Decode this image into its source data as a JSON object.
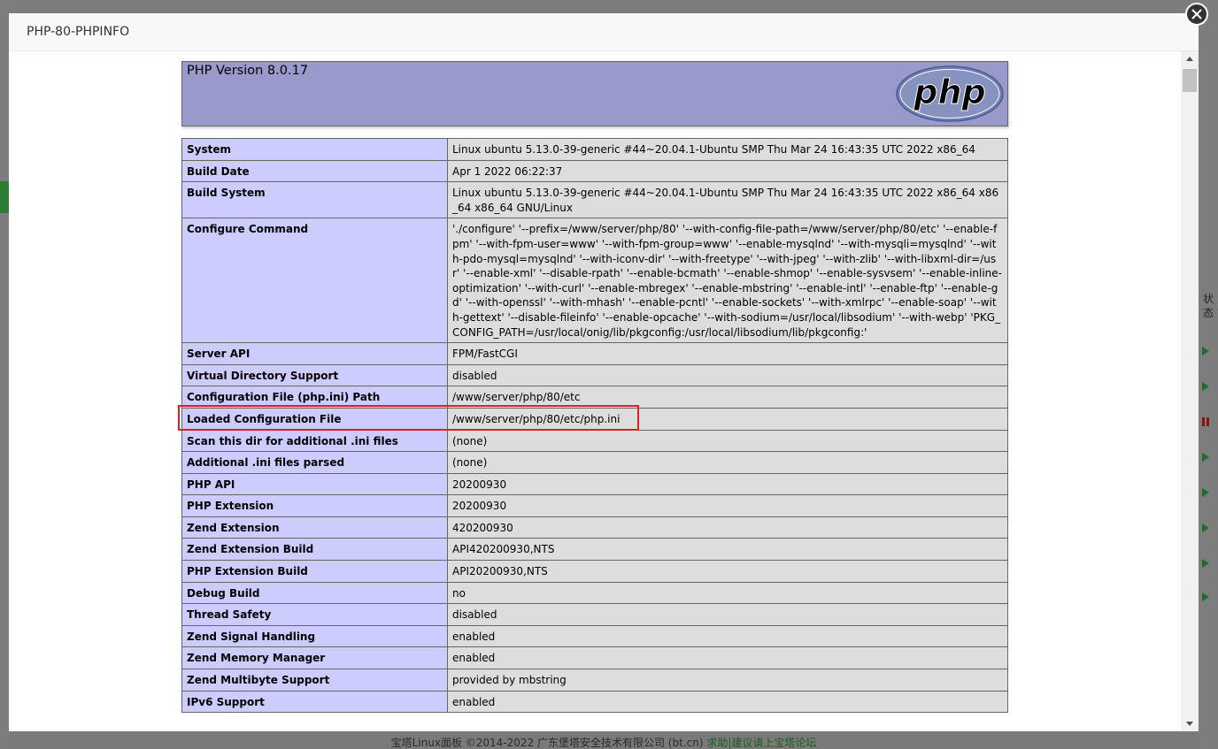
{
  "dialog": {
    "title": "PHP-80-PHPINFO"
  },
  "phpinfo": {
    "version": "PHP Version 8.0.17",
    "logo_text": "php",
    "rows": [
      {
        "label": "System",
        "value": "Linux ubuntu 5.13.0-39-generic #44~20.04.1-Ubuntu SMP Thu Mar 24 16:43:35 UTC 2022 x86_64"
      },
      {
        "label": "Build Date",
        "value": "Apr 1 2022 06:22:37"
      },
      {
        "label": "Build System",
        "value": "Linux ubuntu 5.13.0-39-generic #44~20.04.1-Ubuntu SMP Thu Mar 24 16:43:35 UTC 2022 x86_64 x86_64 x86_64 GNU/Linux"
      },
      {
        "label": "Configure Command",
        "value": "'./configure' '--prefix=/www/server/php/80' '--with-config-file-path=/www/server/php/80/etc' '--enable-fpm' '--with-fpm-user=www' '--with-fpm-group=www' '--enable-mysqlnd' '--with-mysqli=mysqlnd' '--with-pdo-mysql=mysqlnd' '--with-iconv-dir' '--with-freetype' '--with-jpeg' '--with-zlib' '--with-libxml-dir=/usr' '--enable-xml' '--disable-rpath' '--enable-bcmath' '--enable-shmop' '--enable-sysvsem' '--enable-inline-optimization' '--with-curl' '--enable-mbregex' '--enable-mbstring' '--enable-intl' '--enable-ftp' '--enable-gd' '--with-openssl' '--with-mhash' '--enable-pcntl' '--enable-sockets' '--with-xmlrpc' '--enable-soap' '--with-gettext' '--disable-fileinfo' '--enable-opcache' '--with-sodium=/usr/local/libsodium' '--with-webp' 'PKG_CONFIG_PATH=/usr/local/onig/lib/pkgconfig:/usr/local/libsodium/lib/pkgconfig:'"
      },
      {
        "label": "Server API",
        "value": "FPM/FastCGI"
      },
      {
        "label": "Virtual Directory Support",
        "value": "disabled"
      },
      {
        "label": "Configuration File (php.ini) Path",
        "value": "/www/server/php/80/etc"
      },
      {
        "label": "Loaded Configuration File",
        "value": "/www/server/php/80/etc/php.ini"
      },
      {
        "label": "Scan this dir for additional .ini files",
        "value": "(none)"
      },
      {
        "label": "Additional .ini files parsed",
        "value": "(none)"
      },
      {
        "label": "PHP API",
        "value": "20200930"
      },
      {
        "label": "PHP Extension",
        "value": "20200930"
      },
      {
        "label": "Zend Extension",
        "value": "420200930"
      },
      {
        "label": "Zend Extension Build",
        "value": "API420200930,NTS"
      },
      {
        "label": "PHP Extension Build",
        "value": "API20200930,NTS"
      },
      {
        "label": "Debug Build",
        "value": "no"
      },
      {
        "label": "Thread Safety",
        "value": "disabled"
      },
      {
        "label": "Zend Signal Handling",
        "value": "enabled"
      },
      {
        "label": "Zend Memory Manager",
        "value": "enabled"
      },
      {
        "label": "Zend Multibyte Support",
        "value": "provided by mbstring"
      },
      {
        "label": "IPv6 Support",
        "value": "enabled"
      }
    ]
  },
  "background": {
    "status_label": "状态",
    "footer_text": "宝塔Linux面板 ©2014-2022 广东堡塔安全技术有限公司 (bt.cn)",
    "footer_link": "求助|建议请上宝塔论坛"
  },
  "colors": {
    "header_bg": "#9999cc",
    "label_bg": "#ccccff",
    "value_bg": "#dddddd",
    "highlight_border": "#e02020"
  }
}
